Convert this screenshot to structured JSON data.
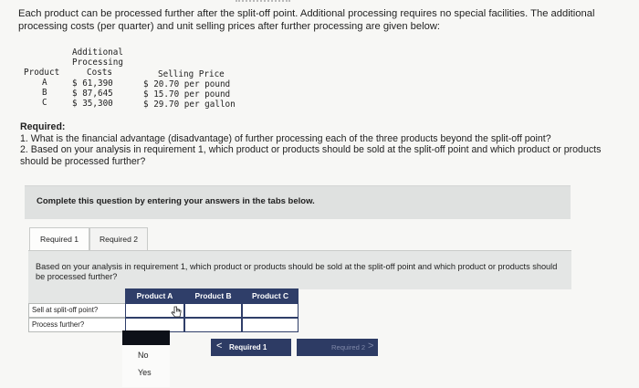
{
  "intro": "Each product can be processed further after the split-off point. Additional processing requires no special facilities. The additional processing costs (per quarter) and unit selling prices after further processing are given below:",
  "cost_table": {
    "header_additional": "Additional",
    "header_processing": "Processing",
    "header_costs": "Costs",
    "header_product": "Product",
    "header_selling": "Selling Price",
    "rows": [
      {
        "product": "A",
        "cost": "$ 61,390",
        "price": "$ 20.70 per pound"
      },
      {
        "product": "B",
        "cost": "$ 87,645",
        "price": "$ 15.70 per pound"
      },
      {
        "product": "C",
        "cost": "$ 35,300",
        "price": "$ 29.70 per gallon"
      }
    ]
  },
  "required": {
    "heading": "Required:",
    "item1": "1. What is the financial advantage (disadvantage) of further processing each of the three products beyond the split-off point?",
    "item2": "2. Based on your analysis in requirement 1, which product or products should be sold at the split-off point and which product or products should be processed further?"
  },
  "banner": "Complete this question by entering your answers in the tabs below.",
  "tabs": [
    {
      "label": "Required 1"
    },
    {
      "label": "Required 2"
    }
  ],
  "panel_text": "Based on your analysis in requirement 1, which product or products should be sold at the split-off point and which product or products should be processed further?",
  "grid": {
    "columns": [
      "Product A",
      "Product B",
      "Product C"
    ],
    "rows": [
      "Sell at split-off point?",
      "Process further?"
    ]
  },
  "dropdown": {
    "options": [
      "No",
      "Yes"
    ]
  },
  "nav": {
    "prev_label": "Required 1",
    "next_label": "Required 2",
    "prev_chevron": "<",
    "next_chevron": ">"
  }
}
